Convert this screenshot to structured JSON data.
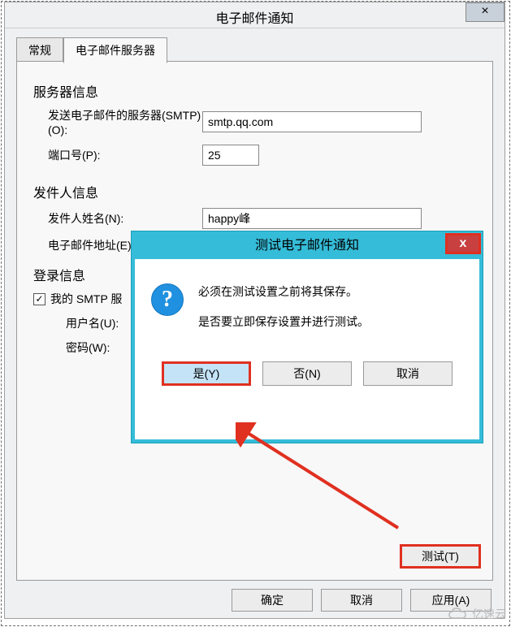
{
  "window": {
    "title": "电子邮件通知",
    "close_x": "×"
  },
  "tabs": {
    "general": "常规",
    "email_server": "电子邮件服务器"
  },
  "server_info": {
    "title": "服务器信息",
    "smtp_label": "发送电子邮件的服务器(SMTP)(O):",
    "smtp_value": "smtp.qq.com",
    "port_label": "端口号(P):",
    "port_value": "25"
  },
  "sender_info": {
    "title": "发件人信息",
    "name_label": "发件人姓名(N):",
    "name_value": "happy峰",
    "email_label": "电子邮件地址(E)"
  },
  "login_info": {
    "title": "登录信息",
    "checkbox_label": "我的 SMTP 服",
    "checkbox_checked": "✓",
    "username_label": "用户名(U):",
    "password_label": "密码(W):"
  },
  "buttons": {
    "test": "测试(T)",
    "ok": "确定",
    "cancel": "取消",
    "apply": "应用(A)"
  },
  "modal": {
    "title": "测试电子邮件通知",
    "close_x": "x",
    "line1": "必须在测试设置之前将其保存。",
    "line2": "是否要立即保存设置并进行测试。",
    "yes": "是(Y)",
    "no": "否(N)",
    "cancel": "取消"
  },
  "watermark": "亿速云"
}
